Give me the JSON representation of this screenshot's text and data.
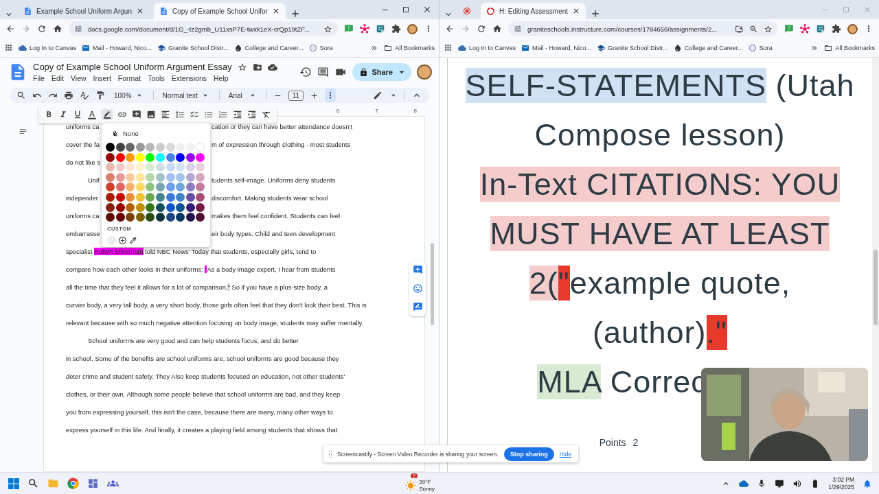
{
  "left_window": {
    "tabs": [
      {
        "title": "Example School Uniform Argun",
        "selected": false
      },
      {
        "title": "Copy of Example School Unifor",
        "selected": true
      }
    ],
    "address": "docs.google.com/document/d/1G_-tz2gmb_U11xsP7E-twxk1eX-crQp19tZF...",
    "bookmarks": [
      "Log In to Canvas",
      "Mail - Howard, Nico...",
      "Granite School Distr...",
      "College and Career...",
      "Sora"
    ],
    "all_bookmarks": "All Bookmarks",
    "document": {
      "title": "Copy of Example School Uniform Argument Essay",
      "menu": [
        "File",
        "Edit",
        "View",
        "Insert",
        "Format",
        "Tools",
        "Extensions",
        "Help"
      ],
      "share": "Share",
      "zoom": "100%",
      "style": "Normal text",
      "font": "Arial",
      "font_size": "11",
      "ruler": [
        "6",
        "7",
        "8"
      ],
      "palette": {
        "none": "None",
        "custom": "CUSTOM",
        "rows": [
          [
            {
              "color": "#000000"
            },
            {
              "color": "#434343"
            },
            {
              "color": "#666666"
            },
            {
              "color": "#999999"
            },
            {
              "color": "#b7b7b7"
            },
            {
              "color": "#cccccc"
            },
            {
              "color": "#d9d9d9"
            },
            {
              "color": "#efefef"
            },
            {
              "color": "#f3f3f3"
            },
            {
              "color": "#ffffff"
            }
          ],
          [
            {
              "color": "#980000"
            },
            {
              "color": "#ff0000"
            },
            {
              "color": "#ff9900"
            },
            {
              "color": "#ffff00"
            },
            {
              "color": "#00ff00"
            },
            {
              "color": "#00ffff"
            },
            {
              "color": "#4a86e8"
            },
            {
              "color": "#0000ff"
            },
            {
              "color": "#9900ff"
            },
            {
              "color": "#ff00ff"
            }
          ],
          [
            {
              "color": "#e6b8af"
            },
            {
              "color": "#f4cccc"
            },
            {
              "color": "#fce5cd"
            },
            {
              "color": "#fff2cc"
            },
            {
              "color": "#d9ead3"
            },
            {
              "color": "#d0e0e3"
            },
            {
              "color": "#c9daf8"
            },
            {
              "color": "#cfe2f3"
            },
            {
              "color": "#d9d2e9"
            },
            {
              "color": "#ead1dc"
            }
          ],
          [
            {
              "color": "#dd7e6b"
            },
            {
              "color": "#ea9999"
            },
            {
              "color": "#f9cb9c"
            },
            {
              "color": "#ffe599"
            },
            {
              "color": "#b6d7a8"
            },
            {
              "color": "#a2c4c9"
            },
            {
              "color": "#a4c2f4"
            },
            {
              "color": "#9fc5e8"
            },
            {
              "color": "#b4a7d6"
            },
            {
              "color": "#d5a6bd"
            }
          ],
          [
            {
              "color": "#cc4125"
            },
            {
              "color": "#e06666"
            },
            {
              "color": "#f6b26b"
            },
            {
              "color": "#ffd966"
            },
            {
              "color": "#93c47d"
            },
            {
              "color": "#76a5af"
            },
            {
              "color": "#6d9eeb"
            },
            {
              "color": "#6fa8dc"
            },
            {
              "color": "#8e7cc3"
            },
            {
              "color": "#c27ba0"
            }
          ],
          [
            {
              "color": "#a61c00"
            },
            {
              "color": "#cc0000"
            },
            {
              "color": "#e69138"
            },
            {
              "color": "#f1c232"
            },
            {
              "color": "#6aa84f"
            },
            {
              "color": "#45818e"
            },
            {
              "color": "#3c78d8"
            },
            {
              "color": "#3d85c6"
            },
            {
              "color": "#674ea7"
            },
            {
              "color": "#a64d79"
            }
          ],
          [
            {
              "color": "#85200c"
            },
            {
              "color": "#990000"
            },
            {
              "color": "#b45f06"
            },
            {
              "color": "#bf9000"
            },
            {
              "color": "#38761d"
            },
            {
              "color": "#134f5c"
            },
            {
              "color": "#1155cc"
            },
            {
              "color": "#0b5394"
            },
            {
              "color": "#351c75"
            },
            {
              "color": "#741b47"
            }
          ],
          [
            {
              "color": "#5b0f00"
            },
            {
              "color": "#660000"
            },
            {
              "color": "#783f04"
            },
            {
              "color": "#7f6000"
            },
            {
              "color": "#274e13"
            },
            {
              "color": "#0c343d"
            },
            {
              "color": "#1c4587"
            },
            {
              "color": "#073763"
            },
            {
              "color": "#20124d"
            },
            {
              "color": "#4c1130"
            }
          ]
        ]
      },
      "lines": [
        {
          "kind": "split",
          "indent": false,
          "left": "uniforms ca",
          "right": "cation or they can have better attendance doesn't"
        },
        {
          "kind": "split",
          "indent": false,
          "left": "cover the fa",
          "right": "m of expression through clothing - most students"
        },
        {
          "kind": "split",
          "indent": false,
          "left": "do not like s"
        },
        {
          "kind": "split",
          "indent": true,
          "left": "Unif",
          "right": "tudents self-image. Uniforms deny students"
        },
        {
          "kind": "split",
          "indent": false,
          "left": "independer",
          "right": "discomfort. Making students wear school"
        },
        {
          "kind": "split",
          "indent": false,
          "left": "uniforms ca",
          "right": "makes them feel confident. Students can feel"
        },
        {
          "kind": "split",
          "indent": false,
          "left": "embarrasse",
          "right": "eir body types. Child and teen development"
        },
        {
          "kind": "full",
          "indent": false,
          "segments": [
            {
              "text": "specialist "
            },
            {
              "text": "Robyn Silverman",
              "color": "#ff00ff"
            },
            {
              "text": " told NBC News' Today that students, especially girls, tend to"
            }
          ]
        },
        {
          "kind": "full",
          "indent": false,
          "segments": [
            {
              "text": "compare how each other looks in their uniforms: "
            },
            {
              "text": "\"",
              "color": "#ff00ff"
            },
            {
              "text": "As a body image expert, I hear from students"
            }
          ]
        },
        {
          "kind": "full",
          "indent": false,
          "segments": [
            {
              "text": "all the time that they feel it allows for a lot of comparison."
            },
            {
              "text": "\"",
              "color": "#d9d9d9"
            },
            {
              "text": " So if you have a plus-size body, a"
            }
          ]
        },
        {
          "kind": "full",
          "indent": false,
          "segments": [
            {
              "text": "curvier body, a very tall body, a very short body, those girls often feel that they don't look their best. This is"
            }
          ]
        },
        {
          "kind": "full",
          "indent": false,
          "segments": [
            {
              "text": "relevant because with so much negative attention focusing on body image, students may suffer mentally."
            }
          ]
        },
        {
          "kind": "full",
          "indent": true,
          "segments": [
            {
              "text": "School uniforms are very good and can help students focus, and do better"
            }
          ]
        },
        {
          "kind": "full",
          "indent": false,
          "segments": [
            {
              "text": "in school. Some of the benefits are school uniforms are, school uniforms are good because they"
            }
          ]
        },
        {
          "kind": "full",
          "indent": false,
          "segments": [
            {
              "text": "deter crime and student safety. They Also keep students focused on education, not other students'"
            }
          ]
        },
        {
          "kind": "full",
          "indent": false,
          "segments": [
            {
              "text": "clothes, or their own. Although some people believe that school uniforms are bad, and they keep"
            }
          ]
        },
        {
          "kind": "full",
          "indent": false,
          "segments": [
            {
              "text": "you from expressing yourself, this isn't the case, because there are many, many other ways to"
            }
          ]
        },
        {
          "kind": "full",
          "indent": false,
          "segments": [
            {
              "text": "express yourself in this life. And finally, it creates a playing field among students that shows that"
            }
          ]
        }
      ]
    }
  },
  "right_window": {
    "tabs": [
      {
        "kind": "pinned",
        "selected": false
      },
      {
        "kind": "page",
        "title": "H: Editing Assessment",
        "selected": true
      }
    ],
    "address": "graniteschools.instructure.com/courses/1784656/assignments/2...",
    "bookmarks": [
      "Log In to Canvas",
      "Mail - Howard, Nico...",
      "Granite School Distr...",
      "College and Career...",
      "Sora"
    ],
    "all_bookmarks": "All Bookmarks",
    "content": {
      "lines": [
        [
          {
            "text": "SELF-STATEMENTS",
            "color": "#cfe2f3"
          },
          {
            "text": " (Utah"
          }
        ],
        [
          {
            "text": "Compose lesson)"
          }
        ],
        [
          {
            "text": "In-Text CITATIONS: YOU",
            "color": "#f4cccc"
          }
        ],
        [
          {
            "text": "MUST HAVE AT LEAST",
            "color": "#f4cccc"
          }
        ],
        [
          {
            "text": "2(",
            "color": "#f4cccc"
          },
          {
            "text": "\"",
            "color": "#e8392d"
          },
          {
            "text": "example quote,"
          }
        ],
        [
          {
            "text": "(author)"
          },
          {
            "text": ".\"",
            "color": "#e8392d"
          }
        ],
        [
          {
            "text": "MLA",
            "color": "#d9ead3"
          },
          {
            "text": " Correc"
          }
        ]
      ],
      "points_label": "Points",
      "points": "2"
    }
  },
  "share_bar": {
    "message": "Screencastify - Screen Video Recorder is sharing your screen.",
    "stop": "Stop sharing",
    "hide": "Hide"
  },
  "taskbar": {
    "weather": {
      "badge": "2",
      "temperature": "39°F",
      "condition": "Sunny"
    },
    "time": "3:02 PM",
    "date": "1/29/2025"
  }
}
